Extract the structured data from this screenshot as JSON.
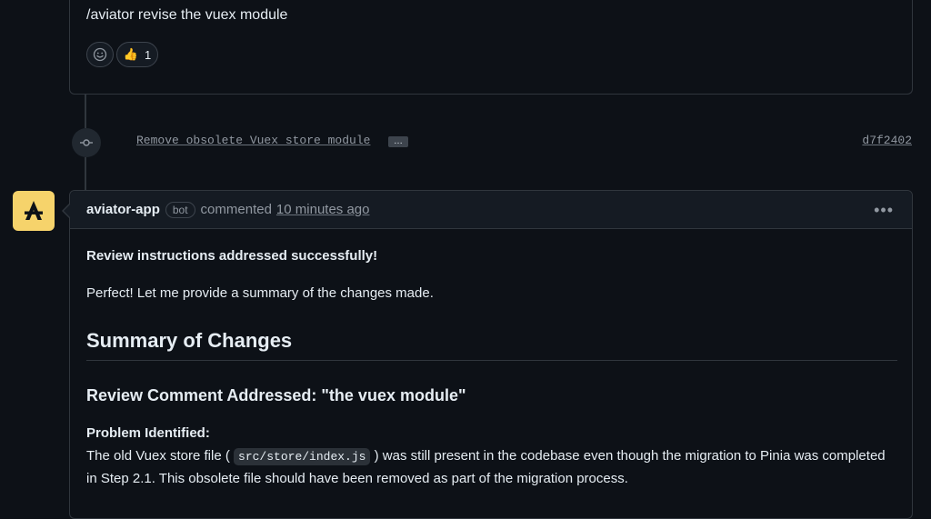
{
  "previous_comment": {
    "text": "/aviator revise the vuex module",
    "reactions": [
      {
        "icon": "smiley-icon",
        "count": ""
      },
      {
        "icon": "thumbs-up-icon",
        "emoji": "👍",
        "count": "1"
      }
    ]
  },
  "commit": {
    "message": "Remove obsolete Vuex store module",
    "ellipsis": "…",
    "sha": "d7f2402",
    "icon": "git-commit-icon"
  },
  "comment": {
    "author": "aviator-app",
    "badge": "bot",
    "action": "commented",
    "time": "10 minutes ago",
    "menu_icon": "kebab-icon",
    "menu_glyph": "•••",
    "avatar_color": "#f6d36b",
    "body": {
      "status": "Review instructions addressed successfully!",
      "intro": "Perfect! Let me provide a summary of the changes made.",
      "heading": "Summary of Changes",
      "subheading": "Review Comment Addressed: \"the vuex module\"",
      "problem_label": "Problem Identified:",
      "problem_text_before": "The old Vuex store file (",
      "problem_code": "src/store/index.js",
      "problem_text_after": ") was still present in the codebase even though the migration to Pinia was completed in Step 2.1. This obsolete file should have been removed as part of the migration process."
    }
  }
}
